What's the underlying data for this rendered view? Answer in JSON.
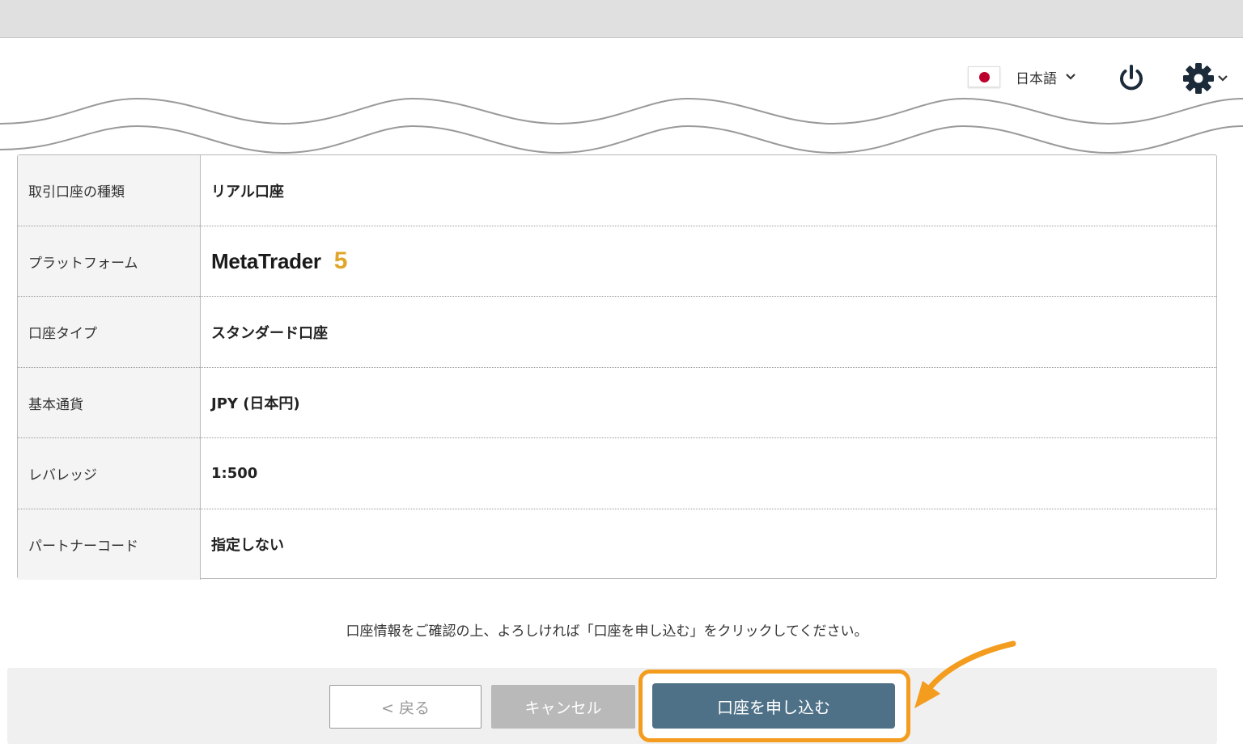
{
  "header": {
    "language": {
      "label": "日本語",
      "flag_icon": "japan-flag-icon"
    },
    "power_icon": "power-icon",
    "settings_icon": "gear-icon"
  },
  "account_info": [
    {
      "key": "取引口座の種類",
      "value": "リアル口座"
    },
    {
      "key": "プラットフォーム",
      "value_logo_text": "MetaTrader",
      "value_logo_number": "5"
    },
    {
      "key": "口座タイプ",
      "value": "スタンダード口座"
    },
    {
      "key": "基本通貨",
      "value": "JPY (日本円)"
    },
    {
      "key": "レバレッジ",
      "value": "1:500"
    },
    {
      "key": "パートナーコード",
      "value": "指定しない"
    }
  ],
  "notice": "口座情報をご確認の上、よろしければ「口座を申し込む」をクリックしてください。",
  "buttons": {
    "back": "< 戻る",
    "cancel": "キャンセル",
    "apply": "口座を申し込む"
  },
  "colors": {
    "accent_highlight": "#f39c1e",
    "apply_button": "#4f7188",
    "metatrader_5": "#e1a52a"
  }
}
